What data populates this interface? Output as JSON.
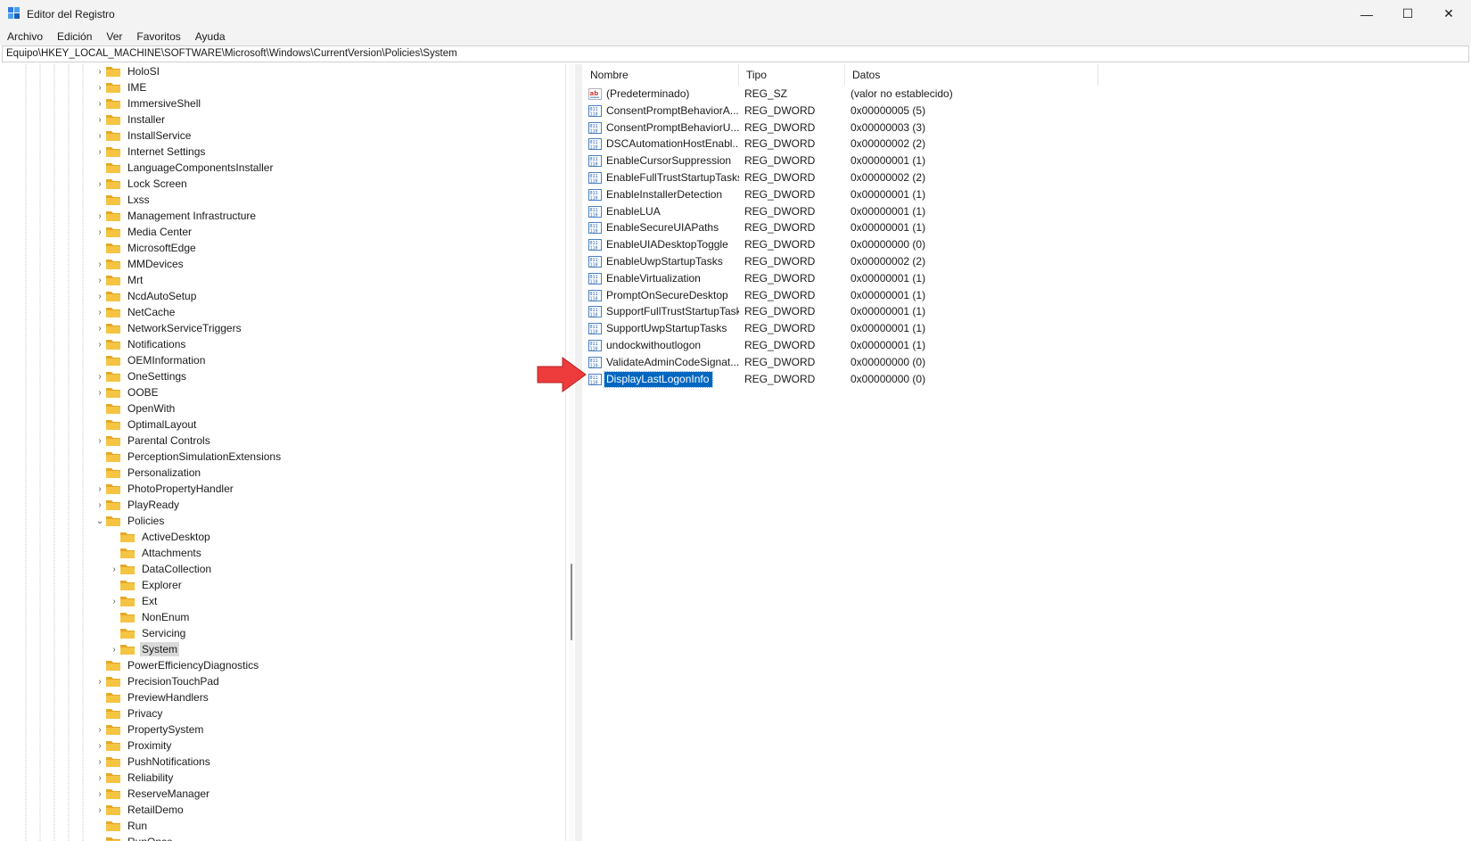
{
  "window": {
    "title": "Editor del Registro",
    "minimize_glyph": "—",
    "maximize_glyph": "☐",
    "close_glyph": "✕"
  },
  "menu": [
    "Archivo",
    "Edición",
    "Ver",
    "Favoritos",
    "Ayuda"
  ],
  "address": "Equipo\\HKEY_LOCAL_MACHINE\\SOFTWARE\\Microsoft\\Windows\\CurrentVersion\\Policies\\System",
  "tree": {
    "items": [
      {
        "label": "HoloSI",
        "expander": "›"
      },
      {
        "label": "IME",
        "expander": "›"
      },
      {
        "label": "ImmersiveShell",
        "expander": "›"
      },
      {
        "label": "Installer",
        "expander": "›"
      },
      {
        "label": "InstallService",
        "expander": "›"
      },
      {
        "label": "Internet Settings",
        "expander": "›"
      },
      {
        "label": "LanguageComponentsInstaller",
        "expander": ""
      },
      {
        "label": "Lock Screen",
        "expander": "›"
      },
      {
        "label": "Lxss",
        "expander": ""
      },
      {
        "label": "Management Infrastructure",
        "expander": "›"
      },
      {
        "label": "Media Center",
        "expander": "›"
      },
      {
        "label": "MicrosoftEdge",
        "expander": ""
      },
      {
        "label": "MMDevices",
        "expander": "›"
      },
      {
        "label": "Mrt",
        "expander": "›"
      },
      {
        "label": "NcdAutoSetup",
        "expander": "›"
      },
      {
        "label": "NetCache",
        "expander": "›"
      },
      {
        "label": "NetworkServiceTriggers",
        "expander": "›"
      },
      {
        "label": "Notifications",
        "expander": "›"
      },
      {
        "label": "OEMInformation",
        "expander": ""
      },
      {
        "label": "OneSettings",
        "expander": "›"
      },
      {
        "label": "OOBE",
        "expander": "›"
      },
      {
        "label": "OpenWith",
        "expander": ""
      },
      {
        "label": "OptimalLayout",
        "expander": ""
      },
      {
        "label": "Parental Controls",
        "expander": "›"
      },
      {
        "label": "PerceptionSimulationExtensions",
        "expander": ""
      },
      {
        "label": "Personalization",
        "expander": ""
      },
      {
        "label": "PhotoPropertyHandler",
        "expander": "›"
      },
      {
        "label": "PlayReady",
        "expander": "›"
      },
      {
        "label": "Policies",
        "expander": "⌄"
      },
      {
        "label": "ActiveDesktop",
        "expander": "",
        "child": true
      },
      {
        "label": "Attachments",
        "expander": "",
        "child": true
      },
      {
        "label": "DataCollection",
        "expander": "›",
        "child": true
      },
      {
        "label": "Explorer",
        "expander": "",
        "child": true
      },
      {
        "label": "Ext",
        "expander": "›",
        "child": true
      },
      {
        "label": "NonEnum",
        "expander": "",
        "child": true
      },
      {
        "label": "Servicing",
        "expander": "",
        "child": true
      },
      {
        "label": "System",
        "expander": "›",
        "child": true,
        "selected": true
      },
      {
        "label": "PowerEfficiencyDiagnostics",
        "expander": ""
      },
      {
        "label": "PrecisionTouchPad",
        "expander": "›"
      },
      {
        "label": "PreviewHandlers",
        "expander": ""
      },
      {
        "label": "Privacy",
        "expander": ""
      },
      {
        "label": "PropertySystem",
        "expander": "›"
      },
      {
        "label": "Proximity",
        "expander": "›"
      },
      {
        "label": "PushNotifications",
        "expander": "›"
      },
      {
        "label": "Reliability",
        "expander": "›"
      },
      {
        "label": "ReserveManager",
        "expander": "›"
      },
      {
        "label": "RetailDemo",
        "expander": "›"
      },
      {
        "label": "Run",
        "expander": ""
      },
      {
        "label": "RunOnce",
        "expander": ""
      }
    ]
  },
  "values": {
    "headers": {
      "name": "Nombre",
      "type": "Tipo",
      "data": "Datos"
    },
    "rows": [
      {
        "icon": "string-value-icon",
        "name": "(Predeterminado)",
        "type": "REG_SZ",
        "data": "(valor no establecido)"
      },
      {
        "icon": "dword-value-icon",
        "name": "ConsentPromptBehaviorA...",
        "type": "REG_DWORD",
        "data": "0x00000005 (5)"
      },
      {
        "icon": "dword-value-icon",
        "name": "ConsentPromptBehaviorU...",
        "type": "REG_DWORD",
        "data": "0x00000003 (3)"
      },
      {
        "icon": "dword-value-icon",
        "name": "DSCAutomationHostEnabl...",
        "type": "REG_DWORD",
        "data": "0x00000002 (2)"
      },
      {
        "icon": "dword-value-icon",
        "name": "EnableCursorSuppression",
        "type": "REG_DWORD",
        "data": "0x00000001 (1)"
      },
      {
        "icon": "dword-value-icon",
        "name": "EnableFullTrustStartupTasks",
        "type": "REG_DWORD",
        "data": "0x00000002 (2)"
      },
      {
        "icon": "dword-value-icon",
        "name": "EnableInstallerDetection",
        "type": "REG_DWORD",
        "data": "0x00000001 (1)"
      },
      {
        "icon": "dword-value-icon",
        "name": "EnableLUA",
        "type": "REG_DWORD",
        "data": "0x00000001 (1)"
      },
      {
        "icon": "dword-value-icon",
        "name": "EnableSecureUIAPaths",
        "type": "REG_DWORD",
        "data": "0x00000001 (1)"
      },
      {
        "icon": "dword-value-icon",
        "name": "EnableUIADesktopToggle",
        "type": "REG_DWORD",
        "data": "0x00000000 (0)"
      },
      {
        "icon": "dword-value-icon",
        "name": "EnableUwpStartupTasks",
        "type": "REG_DWORD",
        "data": "0x00000002 (2)"
      },
      {
        "icon": "dword-value-icon",
        "name": "EnableVirtualization",
        "type": "REG_DWORD",
        "data": "0x00000001 (1)"
      },
      {
        "icon": "dword-value-icon",
        "name": "PromptOnSecureDesktop",
        "type": "REG_DWORD",
        "data": "0x00000001 (1)"
      },
      {
        "icon": "dword-value-icon",
        "name": "SupportFullTrustStartupTasks",
        "type": "REG_DWORD",
        "data": "0x00000001 (1)"
      },
      {
        "icon": "dword-value-icon",
        "name": "SupportUwpStartupTasks",
        "type": "REG_DWORD",
        "data": "0x00000001 (1)"
      },
      {
        "icon": "dword-value-icon",
        "name": "undockwithoutlogon",
        "type": "REG_DWORD",
        "data": "0x00000001 (1)"
      },
      {
        "icon": "dword-value-icon",
        "name": "ValidateAdminCodeSignat...",
        "type": "REG_DWORD",
        "data": "0x00000000 (0)"
      },
      {
        "icon": "dword-value-icon",
        "name": "DisplayLastLogonInfo",
        "type": "REG_DWORD",
        "data": "0x00000000 (0)",
        "selected": true
      }
    ]
  },
  "colors": {
    "selection": "#0067c0",
    "folder": "#f5c443",
    "folder_dark": "#e3a824",
    "arrow": "#ee3b3b",
    "chrome": "#f3f3f3"
  }
}
